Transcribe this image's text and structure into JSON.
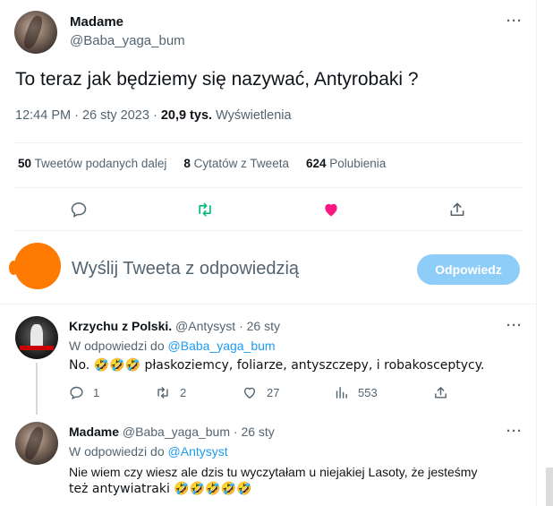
{
  "tweet": {
    "author_name": "Madame",
    "author_handle": "@Baba_yaga_bum",
    "more_label": "···",
    "text": "To teraz jak będziemy się nazywać, Antyrobaki ?",
    "time": "12:44 PM · 26 sty 2023 · ",
    "views_count": "20,9 tys.",
    "views_label": " Wyświetlenia",
    "stats": [
      {
        "count": "50",
        "label": " Tweetów podanych dalej"
      },
      {
        "count": "8",
        "label": " Cytatów z Tweeta"
      },
      {
        "count": "624",
        "label": " Polubienia"
      }
    ],
    "liked": true,
    "colors": {
      "like": "#f91880",
      "retweet": "#00ba7c",
      "icon": "#536471"
    }
  },
  "composer": {
    "placeholder": "Wyślij Tweeta z odpowiedzią",
    "button_label": "Odpowiedz",
    "button_color": "#8ecdf8"
  },
  "replies": [
    {
      "author_name": "Krzychu z Polski.",
      "author_handle": "@Antysyst",
      "date": "· 26 sty",
      "reply_to_prefix": "W odpowiedzi do ",
      "reply_to_handle": "@Baba_yaga_bum",
      "text": "No. 🤣🤣🤣 płaskoziemcy, foliarze, antyszczepy, i robakosceptycy.",
      "counts": {
        "replies": "1",
        "retweets": "2",
        "likes": "27",
        "views": "553"
      }
    },
    {
      "author_name": "Madame",
      "author_handle": "@Baba_yaga_bum",
      "date": "· 26 sty",
      "reply_to_prefix": "W odpowiedzi do ",
      "reply_to_handle": "@Antysyst",
      "text_line1": "Nie wiem czy wiesz ale dzis tu wyczytałam u niejakiej Lasoty,  że jesteśmy",
      "text_line2": "też antywiatraki 🤣🤣🤣🤣🤣"
    }
  ]
}
